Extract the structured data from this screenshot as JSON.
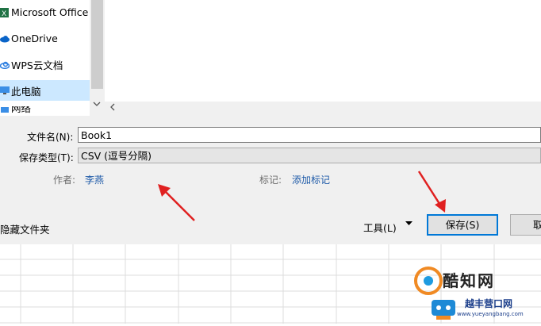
{
  "nav": {
    "items": [
      {
        "label": "Microsoft Office",
        "icon": "excel-icon"
      },
      {
        "label": "OneDrive",
        "icon": "onedrive-cloud-icon"
      },
      {
        "label": "WPS云文档",
        "icon": "wps-cloud-icon"
      },
      {
        "label": "此电脑",
        "icon": "computer-icon"
      },
      {
        "label": "网络",
        "icon": "network-icon"
      }
    ]
  },
  "form": {
    "filename_label": "文件名(N):",
    "filename_value": "Book1",
    "type_label": "保存类型(T):",
    "type_value": "CSV (逗号分隔)",
    "author_label": "作者:",
    "author_value": "李燕",
    "tags_label": "标记:",
    "tags_value": "添加标记"
  },
  "footer": {
    "hide_folders": "隐藏文件夹",
    "tools": "工具(L)",
    "save": "保存(S)",
    "cancel": "取"
  },
  "watermark": {
    "text1": "酷知网",
    "text2": "越丰营口网",
    "url": "www.yueyangbang.com"
  },
  "colors": {
    "accent": "#0078d7",
    "link": "#1e5aa8",
    "arrow": "#e02020",
    "selected_bg": "#cce8ff"
  }
}
